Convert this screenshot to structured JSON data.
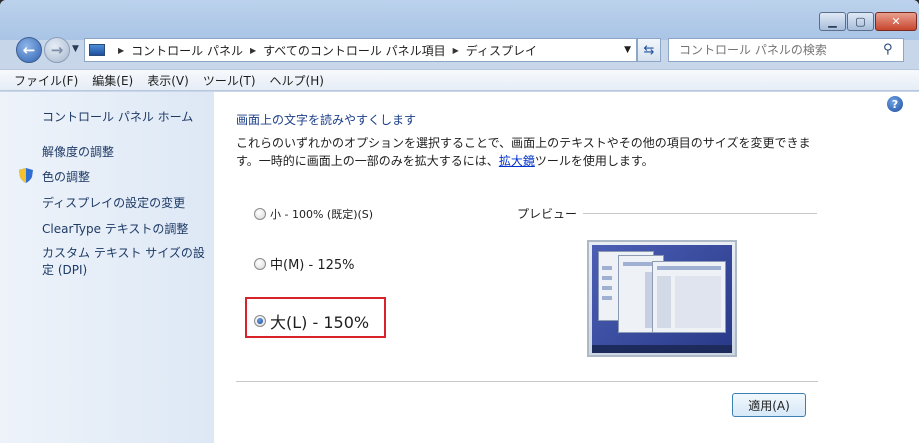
{
  "window": {
    "minimize_glyph": "▁",
    "maximize_glyph": "▢",
    "close_glyph": "✕"
  },
  "nav": {
    "back_glyph": "←",
    "forward_glyph": "→",
    "history_glyph": "▼",
    "breadcrumbs": [
      "コントロール パネル",
      "すべてのコントロール パネル項目",
      "ディスプレイ"
    ],
    "address_dropdown_glyph": "▼",
    "refresh_glyph": "⇆",
    "search_placeholder": "コントロール パネルの検索",
    "search_glyph": "⚲"
  },
  "menu": [
    "ファイル(F)",
    "編集(E)",
    "表示(V)",
    "ツール(T)",
    "ヘルプ(H)"
  ],
  "left_pane": {
    "home": "コントロール パネル ホーム",
    "links": [
      "解像度の調整",
      "色の調整",
      "ディスプレイの設定の変更",
      "ClearType テキストの調整",
      "カスタム テキスト サイズの設定 (DPI)"
    ]
  },
  "main": {
    "help_glyph": "?",
    "title": "画面上の文字を読みやすくします",
    "description_1": "これらのいずれかのオプションを選択することで、画面上のテキストやその他の項目のサイズを変更できます。一時的に画面上の一部のみを拡大するには、",
    "magnifier_link": "拡大鏡",
    "description_2": "ツールを使用します。",
    "options": [
      {
        "label": "小 - 100% (既定)(S)",
        "selected": false
      },
      {
        "label": "中(M) - 125%",
        "selected": false
      },
      {
        "label": "大(L) - 150%",
        "selected": true
      }
    ],
    "preview_label": "プレビュー",
    "apply_label": "適用(A)"
  },
  "colors": {
    "highlight_box": "#d8232a",
    "link": "#1c3f8a"
  }
}
